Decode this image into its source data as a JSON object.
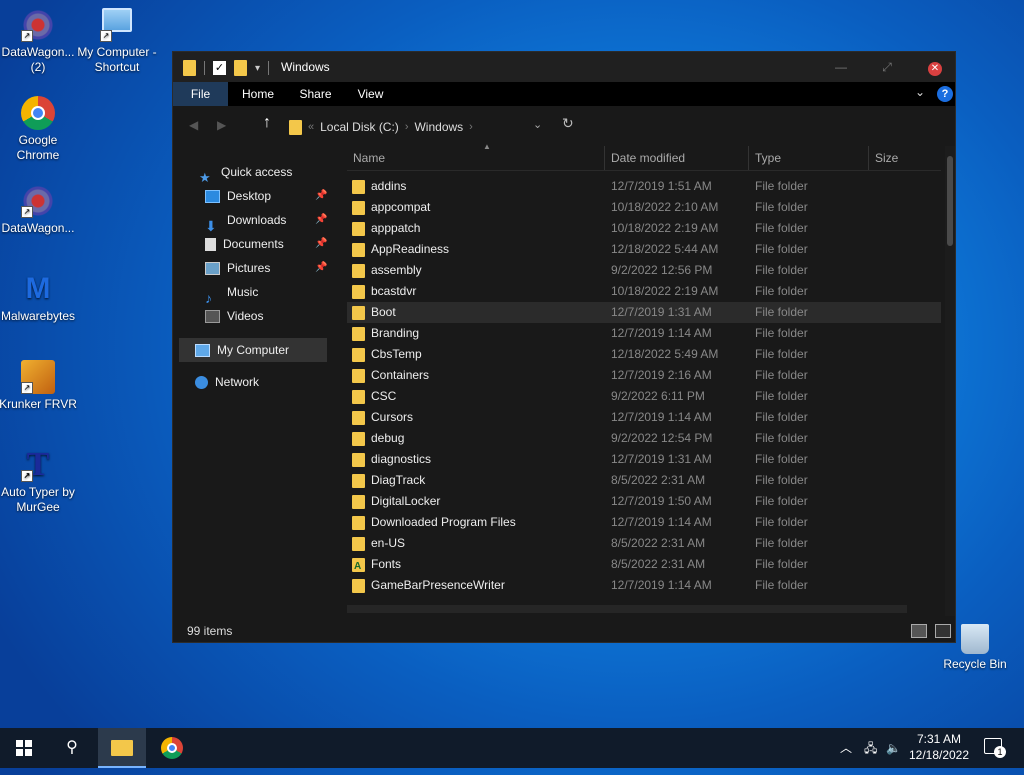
{
  "desktop": {
    "icons": [
      {
        "label": "DataWagon... (2)"
      },
      {
        "label": "My Computer - Shortcut"
      },
      {
        "label": "Google Chrome"
      },
      {
        "label": "DataWagon..."
      },
      {
        "label": "Malwarebytes"
      },
      {
        "label": "Krunker FRVR"
      },
      {
        "label": "Auto Typer by MurGee"
      },
      {
        "label": "Recycle Bin"
      }
    ]
  },
  "window": {
    "title": "Windows",
    "ribbon_tabs": [
      "File",
      "Home",
      "Share",
      "View"
    ],
    "breadcrumb": [
      "Local Disk (C:)",
      "Windows"
    ],
    "nav_pane": {
      "quick_access": "Quick access",
      "items": [
        "Desktop",
        "Downloads",
        "Documents",
        "Pictures",
        "Music",
        "Videos"
      ],
      "my_computer": "My Computer",
      "network": "Network"
    },
    "columns": [
      "Name",
      "Date modified",
      "Type",
      "Size"
    ],
    "rows": [
      {
        "name": "addins",
        "date": "12/7/2019 1:51 AM",
        "type": "File folder"
      },
      {
        "name": "appcompat",
        "date": "10/18/2022 2:10 AM",
        "type": "File folder"
      },
      {
        "name": "apppatch",
        "date": "10/18/2022 2:19 AM",
        "type": "File folder"
      },
      {
        "name": "AppReadiness",
        "date": "12/18/2022 5:44 AM",
        "type": "File folder"
      },
      {
        "name": "assembly",
        "date": "9/2/2022 12:56 PM",
        "type": "File folder"
      },
      {
        "name": "bcastdvr",
        "date": "10/18/2022 2:19 AM",
        "type": "File folder"
      },
      {
        "name": "Boot",
        "date": "12/7/2019 1:31 AM",
        "type": "File folder"
      },
      {
        "name": "Branding",
        "date": "12/7/2019 1:14 AM",
        "type": "File folder"
      },
      {
        "name": "CbsTemp",
        "date": "12/18/2022 5:49 AM",
        "type": "File folder"
      },
      {
        "name": "Containers",
        "date": "12/7/2019 2:16 AM",
        "type": "File folder"
      },
      {
        "name": "CSC",
        "date": "9/2/2022 6:11 PM",
        "type": "File folder"
      },
      {
        "name": "Cursors",
        "date": "12/7/2019 1:14 AM",
        "type": "File folder"
      },
      {
        "name": "debug",
        "date": "9/2/2022 12:54 PM",
        "type": "File folder"
      },
      {
        "name": "diagnostics",
        "date": "12/7/2019 1:31 AM",
        "type": "File folder"
      },
      {
        "name": "DiagTrack",
        "date": "8/5/2022 2:31 AM",
        "type": "File folder"
      },
      {
        "name": "DigitalLocker",
        "date": "12/7/2019 1:50 AM",
        "type": "File folder"
      },
      {
        "name": "Downloaded Program Files",
        "date": "12/7/2019 1:14 AM",
        "type": "File folder"
      },
      {
        "name": "en-US",
        "date": "8/5/2022 2:31 AM",
        "type": "File folder"
      },
      {
        "name": "Fonts",
        "date": "8/5/2022 2:31 AM",
        "type": "File folder"
      },
      {
        "name": "GameBarPresenceWriter",
        "date": "12/7/2019 1:14 AM",
        "type": "File folder"
      }
    ],
    "status_count": "99 items"
  },
  "taskbar": {
    "time": "7:31 AM",
    "date": "12/18/2022",
    "notification_count": "1"
  }
}
